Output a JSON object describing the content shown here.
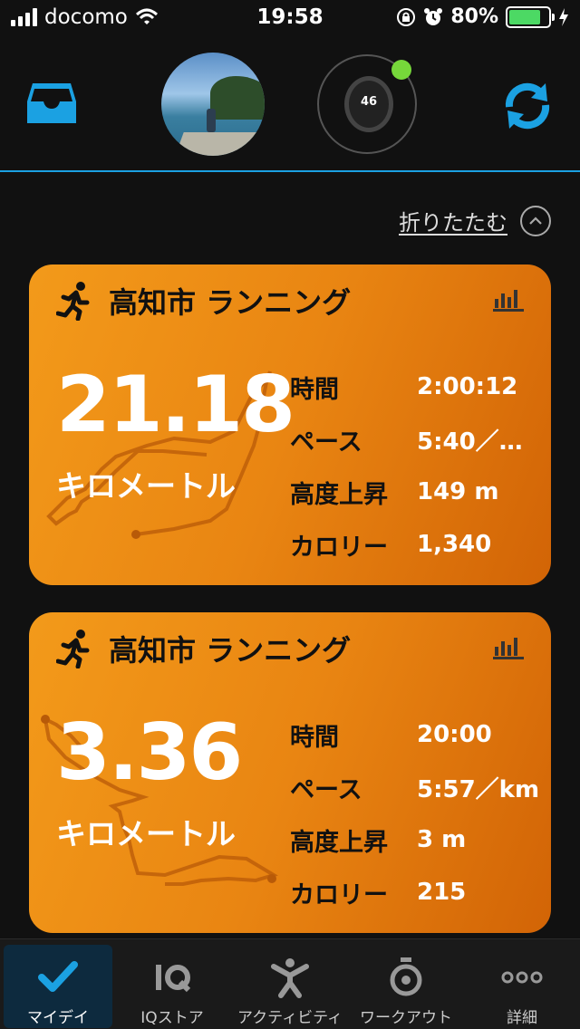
{
  "status": {
    "carrier": "docomo",
    "time": "19:58",
    "battery": "80%",
    "battery_level": 0.8
  },
  "header": {
    "watch_display": "46"
  },
  "collapse": {
    "label": "折りたたむ"
  },
  "activities": [
    {
      "title": "高知市 ランニング",
      "distance": "21.18",
      "unit": "キロメートル",
      "stats": [
        {
          "label": "時間",
          "value": "2:00:12"
        },
        {
          "label": "ペース",
          "value": "5:40／…"
        },
        {
          "label": "高度上昇",
          "value": "149 m"
        },
        {
          "label": "カロリー",
          "value": "1,340"
        }
      ]
    },
    {
      "title": "高知市 ランニング",
      "distance": "3.36",
      "unit": "キロメートル",
      "stats": [
        {
          "label": "時間",
          "value": "20:00"
        },
        {
          "label": "ペース",
          "value": "5:57／km"
        },
        {
          "label": "高度上昇",
          "value": "3 m"
        },
        {
          "label": "カロリー",
          "value": "215"
        }
      ]
    }
  ],
  "nav": {
    "items": [
      {
        "label": "マイデイ",
        "icon": "check-icon",
        "active": true
      },
      {
        "label": "IQストア",
        "icon": "iq-icon",
        "active": false
      },
      {
        "label": "アクティビティ",
        "icon": "activity-person-icon",
        "active": false
      },
      {
        "label": "ワークアウト",
        "icon": "stopwatch-icon",
        "active": false
      },
      {
        "label": "詳細",
        "icon": "more-dots-icon",
        "active": false
      }
    ]
  },
  "colors": {
    "accent": "#1ba1e2",
    "card_start": "#f39a1a",
    "card_end": "#d26406",
    "watch_status": "#76d83a"
  }
}
